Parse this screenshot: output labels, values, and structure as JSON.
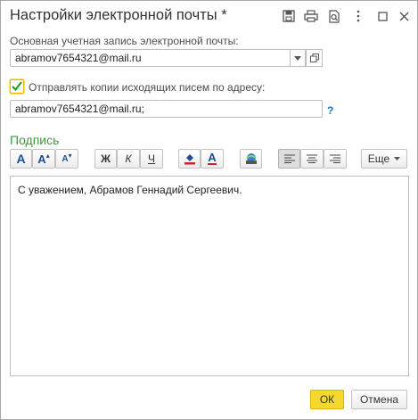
{
  "window": {
    "title": "Настройки электронной почты *"
  },
  "titlebar_icons": [
    "save-icon",
    "print-icon",
    "preview-icon",
    "more-icon",
    "maximize-icon",
    "close-icon"
  ],
  "account": {
    "label": "Основная учетная запись электронной почты:",
    "value": "abramov7654321@mail.ru"
  },
  "copy_option": {
    "checked": true,
    "label": "Отправлять копии исходящих писем по адресу:",
    "value": "abramov7654321@mail.ru;",
    "help": "?"
  },
  "signature": {
    "section_title": "Подпись",
    "text": "С уважением, Абрамов Геннадий Сергеевич."
  },
  "toolbar": {
    "font_normal": "A",
    "font_bigger": "A",
    "font_smaller": "A",
    "bold": "Ж",
    "italic": "К",
    "underline": "Ч",
    "font_color": "A",
    "more": "Еще"
  },
  "footer": {
    "ok": "ОК",
    "cancel": "Отмена"
  },
  "colors": {
    "accent_yellow": "#f5d82d",
    "section_green": "#3c9a3c",
    "help_blue": "#1f6fc5"
  }
}
